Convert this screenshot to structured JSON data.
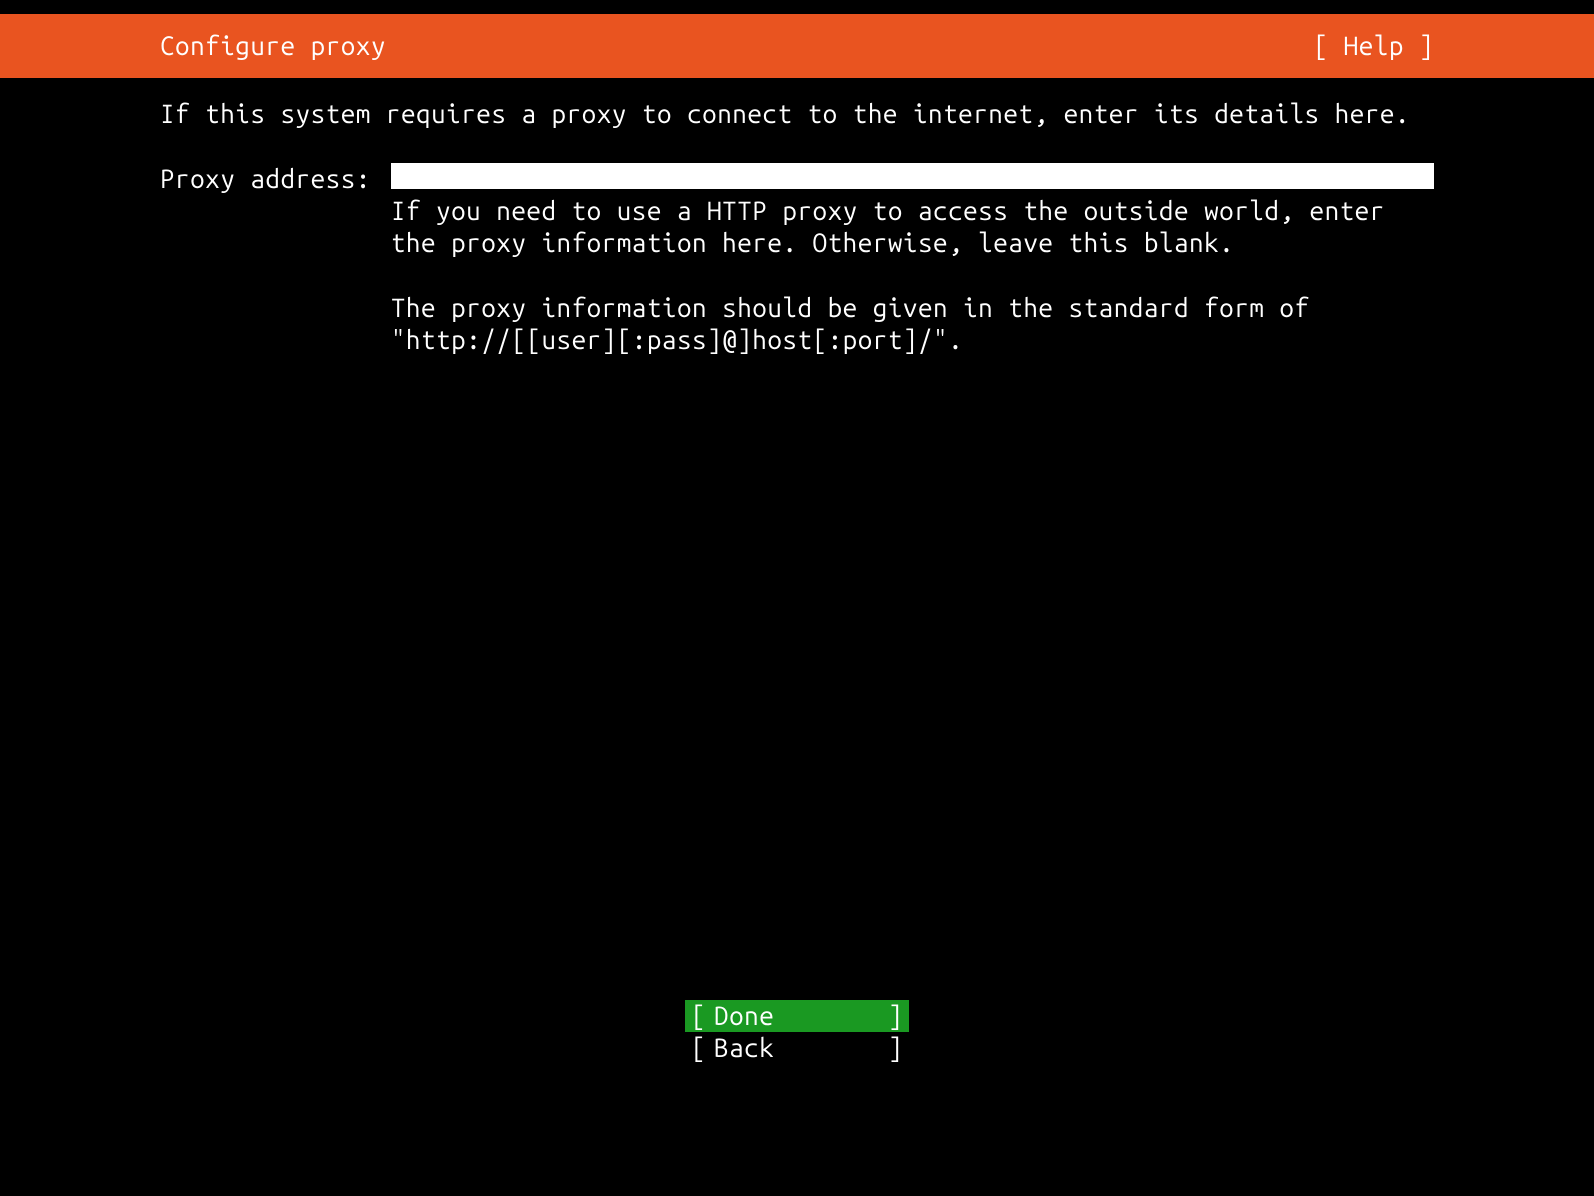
{
  "header": {
    "title": "Configure proxy",
    "help": "[ Help ]"
  },
  "content": {
    "instruction": "If this system requires a proxy to connect to the internet, enter its details here.",
    "form": {
      "label": "Proxy address:",
      "value": "",
      "help_line_1": "If you need to use a HTTP proxy to access the outside world, enter the proxy information here. Otherwise, leave this blank.",
      "help_line_2": "The proxy information should be given in the standard form of \"http://[[user][:pass]@]host[:port]/\"."
    }
  },
  "footer": {
    "done_label": "Done",
    "back_label": "Back"
  },
  "colors": {
    "header_bg": "#e95420",
    "done_bg": "#1a9922",
    "bg": "#000000",
    "text": "#ffffff"
  }
}
